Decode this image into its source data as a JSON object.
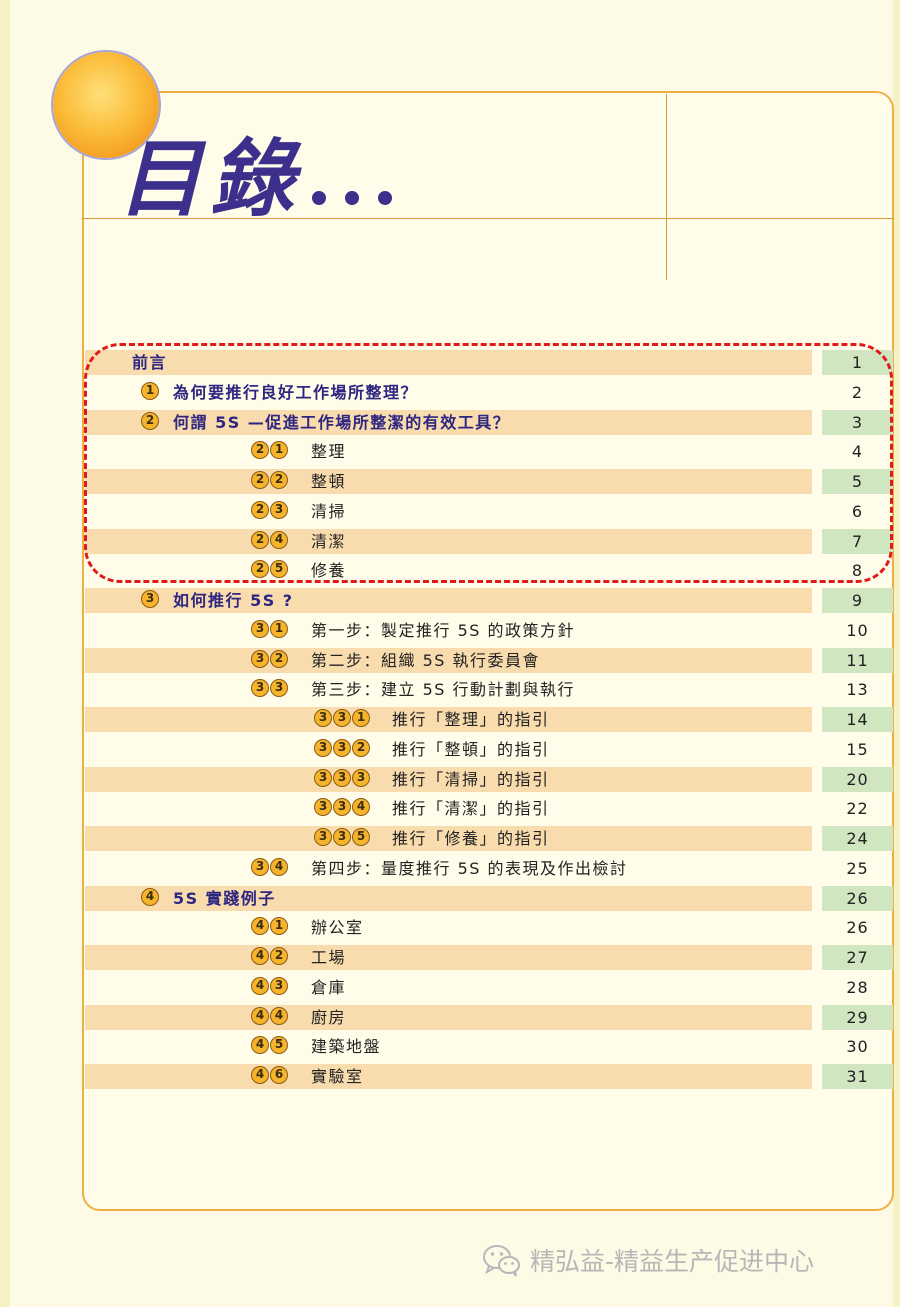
{
  "title": "目錄",
  "toc": [
    {
      "badges": "",
      "label": "前言",
      "page": "1",
      "level": 0
    },
    {
      "badges": "1",
      "label": "為何要推行良好工作場所整理？",
      "page": "2",
      "level": 1
    },
    {
      "badges": "2",
      "label": "何謂 5S —促進工作場所整潔的有效工具？",
      "page": "3",
      "level": 1
    },
    {
      "badges": "21",
      "label": "整理",
      "page": "4",
      "level": 2
    },
    {
      "badges": "22",
      "label": "整頓",
      "page": "5",
      "level": 2
    },
    {
      "badges": "23",
      "label": "清掃",
      "page": "6",
      "level": 2
    },
    {
      "badges": "24",
      "label": "清潔",
      "page": "7",
      "level": 2
    },
    {
      "badges": "25",
      "label": "修養",
      "page": "8",
      "level": 2
    },
    {
      "badges": "3",
      "label": "如何推行 5S ?",
      "page": "9",
      "level": 1
    },
    {
      "badges": "31",
      "label": "第一步：製定推行 5S 的政策方針",
      "page": "10",
      "level": 2
    },
    {
      "badges": "32",
      "label": "第二步：組織 5S 執行委員會",
      "page": "11",
      "level": 2
    },
    {
      "badges": "33",
      "label": "第三步：建立 5S 行動計劃與執行",
      "page": "13",
      "level": 2
    },
    {
      "badges": "331",
      "label": "推行「整理」的指引",
      "page": "14",
      "level": 3
    },
    {
      "badges": "332",
      "label": "推行「整頓」的指引",
      "page": "15",
      "level": 3
    },
    {
      "badges": "333",
      "label": "推行「清掃」的指引",
      "page": "20",
      "level": 3
    },
    {
      "badges": "334",
      "label": "推行「清潔」的指引",
      "page": "22",
      "level": 3
    },
    {
      "badges": "335",
      "label": "推行「修養」的指引",
      "page": "24",
      "level": 3
    },
    {
      "badges": "34",
      "label": "第四步：量度推行 5S 的表現及作出檢討",
      "page": "25",
      "level": 2
    },
    {
      "badges": "4",
      "label": "5S 實踐例子",
      "page": "26",
      "level": 1
    },
    {
      "badges": "41",
      "label": "辦公室",
      "page": "26",
      "level": 2
    },
    {
      "badges": "42",
      "label": "工場",
      "page": "27",
      "level": 2
    },
    {
      "badges": "43",
      "label": "倉庫",
      "page": "28",
      "level": 2
    },
    {
      "badges": "44",
      "label": "廚房",
      "page": "29",
      "level": 2
    },
    {
      "badges": "45",
      "label": "建築地盤",
      "page": "30",
      "level": 2
    },
    {
      "badges": "46",
      "label": "實驗室",
      "page": "31",
      "level": 2
    }
  ],
  "watermark": {
    "text": "精弘益-精益生产促进中心",
    "icon": "wechat-icon"
  },
  "colors": {
    "title": "#3d2f8c",
    "heading_text": "#2e2680",
    "row_band": "#f9dcae",
    "page_band": "#cfe6c0",
    "badge": "#f6b42c",
    "highlight_box": "#e01a1a",
    "frame": "#eeb044"
  }
}
